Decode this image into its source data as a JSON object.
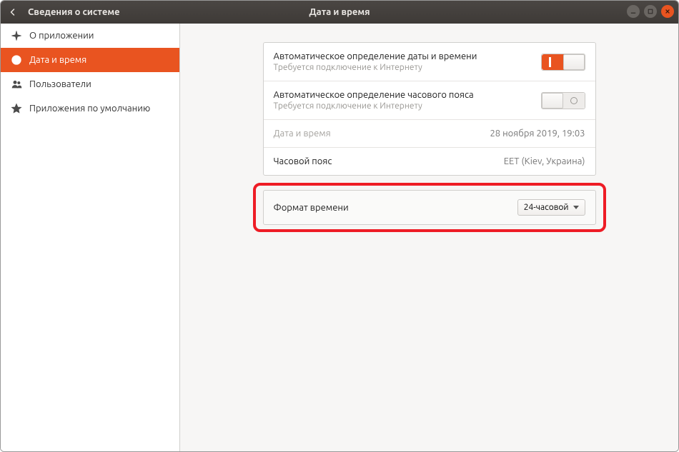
{
  "header": {
    "back_section": "Сведения о системе",
    "title": "Дата и время"
  },
  "sidebar": {
    "items": [
      {
        "label": "О приложении"
      },
      {
        "label": "Дата и время"
      },
      {
        "label": "Пользователи"
      },
      {
        "label": "Приложения по умолчанию"
      }
    ]
  },
  "content": {
    "auto_datetime": {
      "title": "Автоматическое определение даты и времени",
      "sub": "Требуется подключение к Интернету",
      "on": true
    },
    "auto_tz": {
      "title": "Автоматическое определение часового пояса",
      "sub": "Требуется подключение к Интернету",
      "on": false
    },
    "datetime_row": {
      "label": "Дата и время",
      "value": "28 ноября 2019, 19:03"
    },
    "tz_row": {
      "label": "Часовой пояс",
      "value": "EET (Kiev, Украина)"
    }
  },
  "time_format": {
    "label": "Формат времени",
    "selected": "24-часовой"
  },
  "colors": {
    "accent": "#e95420",
    "highlight_ring": "#ee1c25"
  }
}
